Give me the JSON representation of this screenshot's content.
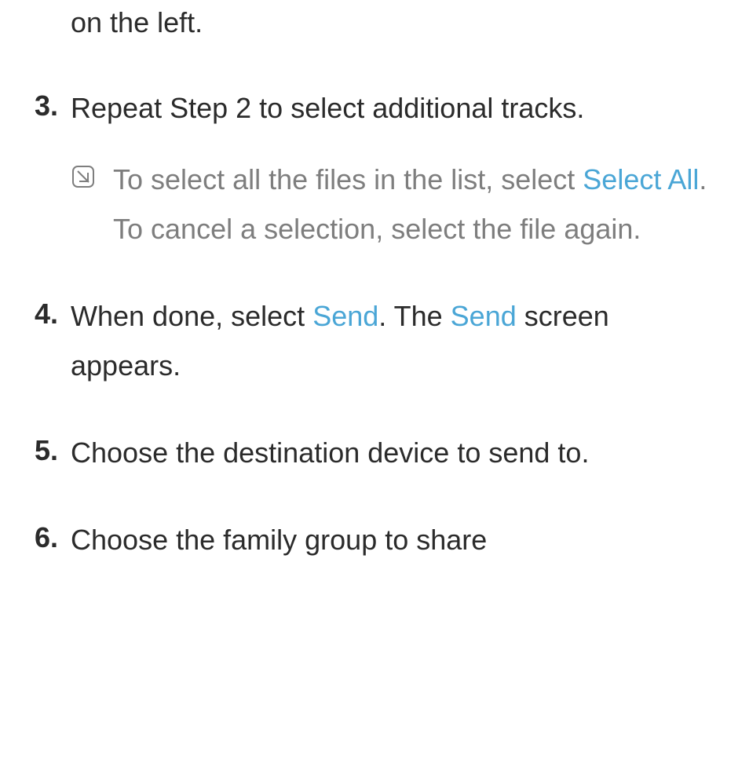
{
  "intro": {
    "text": "on the left."
  },
  "steps": [
    {
      "num": "3.",
      "frags": [
        {
          "t": "text",
          "v": "Repeat Step 2 to select additional tracks."
        }
      ],
      "note": {
        "frags": [
          {
            "t": "note-text",
            "v": "To select all the files in the list, select "
          },
          {
            "t": "note-hl",
            "v": "Select All"
          },
          {
            "t": "note-text",
            "v": ". To cancel a selection, select the file again."
          }
        ]
      }
    },
    {
      "num": "4.",
      "frags": [
        {
          "t": "text",
          "v": "When done, select "
        },
        {
          "t": "hl",
          "v": "Send"
        },
        {
          "t": "text",
          "v": ". The "
        },
        {
          "t": "hl",
          "v": "Send"
        },
        {
          "t": "text",
          "v": " screen appears."
        }
      ]
    },
    {
      "num": "5.",
      "frags": [
        {
          "t": "text",
          "v": "Choose the destination device to send to."
        }
      ]
    },
    {
      "num": "6.",
      "frags": [
        {
          "t": "text",
          "v": "Choose the family group to share"
        }
      ]
    }
  ]
}
